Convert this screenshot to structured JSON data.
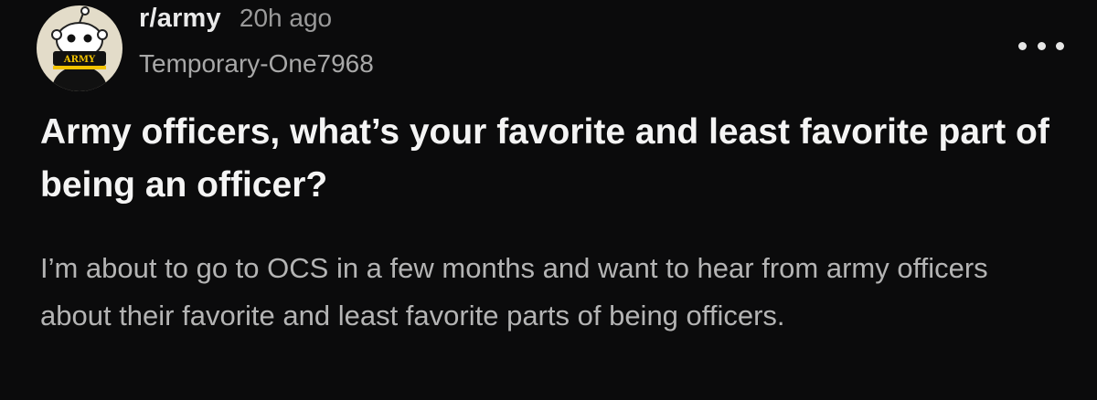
{
  "post": {
    "subreddit": "r/army",
    "time_ago": "20h ago",
    "author": "Temporary-One7968",
    "avatar_text": "ARMY",
    "title": "Army officers, what’s your favorite and least favorite part of being an officer?",
    "body": "I’m about to go to OCS in a few months and want to hear from army officers about their favorite and least favorite parts of being officers.",
    "more_icon": "more-horizontal-icon"
  },
  "colors": {
    "background": "#0b0b0c",
    "title": "#f4f4f4",
    "body": "#b4b4b4",
    "meta": "#9a9a9a",
    "avatar_bg": "#e3dcc9",
    "army_gold": "#f2c300"
  }
}
